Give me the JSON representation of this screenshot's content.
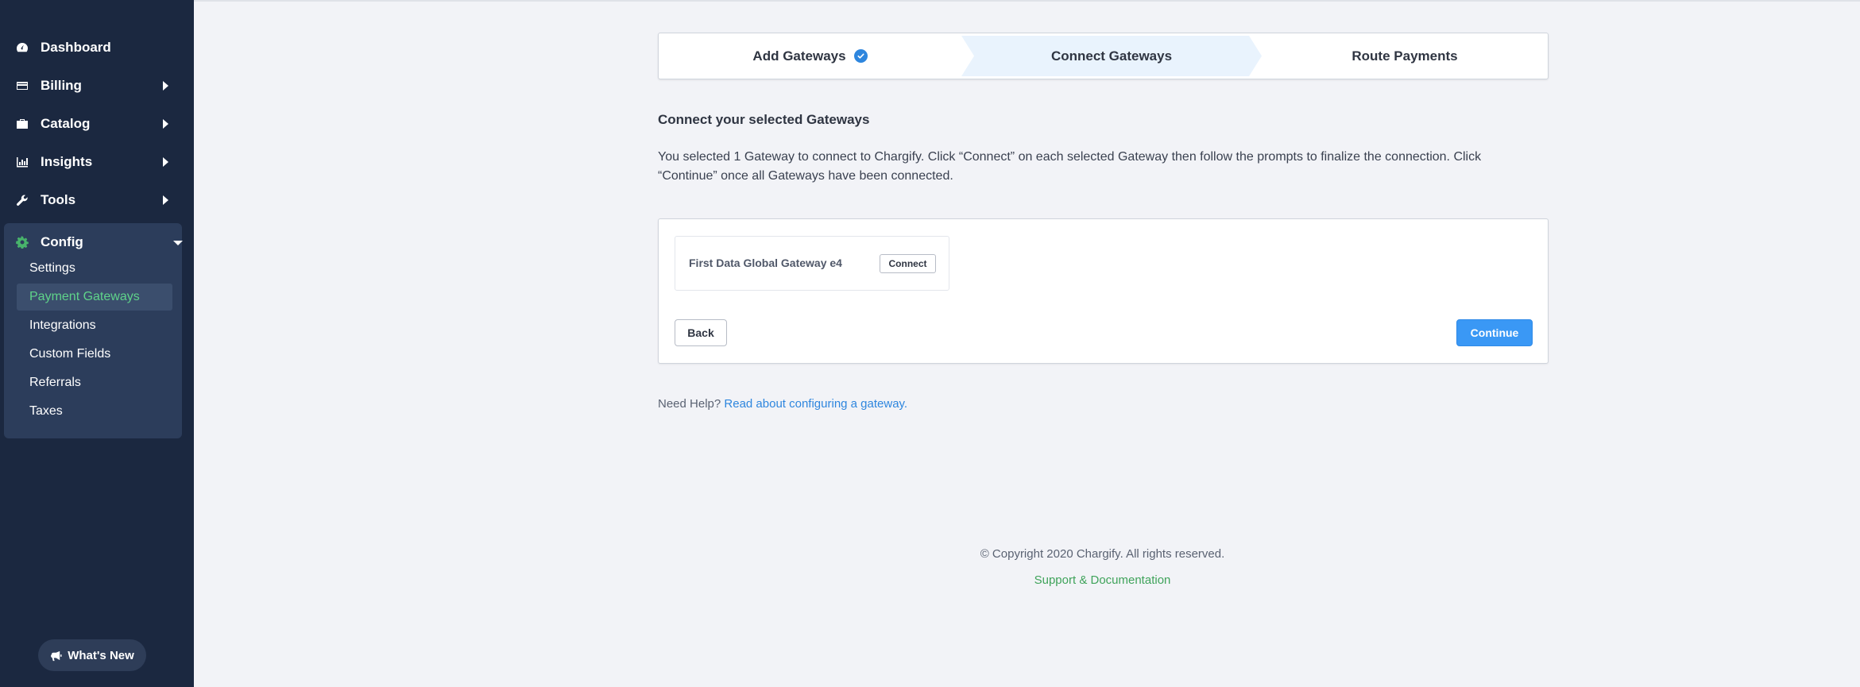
{
  "sidebar": {
    "items": [
      {
        "label": "Dashboard",
        "icon": "dashboard-icon"
      },
      {
        "label": "Billing",
        "icon": "billing-icon"
      },
      {
        "label": "Catalog",
        "icon": "catalog-icon"
      },
      {
        "label": "Insights",
        "icon": "insights-icon"
      },
      {
        "label": "Tools",
        "icon": "tools-icon"
      }
    ],
    "config": {
      "label": "Config",
      "icon": "gear-icon",
      "sub_items": [
        {
          "label": "Settings"
        },
        {
          "label": "Payment Gateways",
          "active": true
        },
        {
          "label": "Integrations"
        },
        {
          "label": "Custom Fields"
        },
        {
          "label": "Referrals"
        },
        {
          "label": "Taxes"
        }
      ]
    },
    "whats_new": {
      "label": "What's New",
      "icon": "megaphone-icon"
    }
  },
  "stepper": {
    "steps": [
      {
        "label": "Add Gateways",
        "state": "completed"
      },
      {
        "label": "Connect Gateways",
        "state": "current"
      },
      {
        "label": "Route Payments",
        "state": "upcoming"
      }
    ]
  },
  "main": {
    "title": "Connect your selected Gateways",
    "description": "You selected 1 Gateway to connect to Chargify. Click “Connect” on each selected Gateway then follow the prompts to finalize the connection. Click “Continue” once all Gateways have been connected.",
    "gateways": [
      {
        "name": "First Data Global Gateway e4",
        "connect_label": "Connect"
      }
    ],
    "back_label": "Back",
    "continue_label": "Continue"
  },
  "help": {
    "prefix": "Need Help?",
    "link_text": "Read about configuring a gateway."
  },
  "footer": {
    "copyright": "© Copyright 2020 Chargify. All rights reserved.",
    "support_link": "Support & Documentation"
  },
  "colors": {
    "sidebar_bg": "#1b2840",
    "config_panel_bg": "#2c3d5b",
    "active_green": "#5fd38a",
    "primary_blue": "#3a98f5",
    "link_blue": "#2e86de",
    "page_bg": "#f2f3f7"
  }
}
